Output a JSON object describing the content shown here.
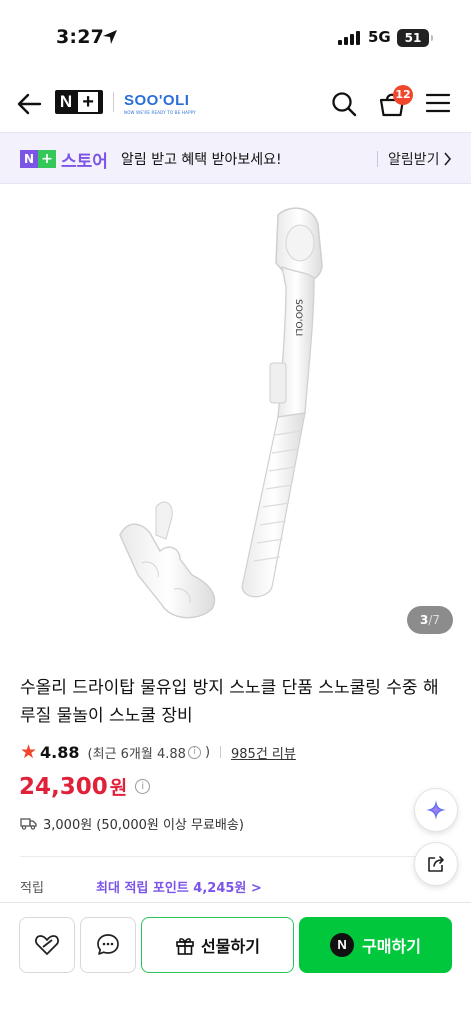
{
  "status_bar": {
    "time": "3:27",
    "network": "5G",
    "battery": "51"
  },
  "header": {
    "nplus_logo": "N",
    "brand_name": "SOO'OLI",
    "brand_tagline": "NOW WE'RE READY TO BE HAPPY",
    "cart_count": "12",
    "icons": [
      "back-arrow-icon",
      "search-icon",
      "cart-icon",
      "menu-icon"
    ]
  },
  "notice": {
    "logo_n": "N",
    "logo_plus": "+",
    "store_label": "스토어",
    "message": "알림 받고 혜택 받아보세요!",
    "action_label": "알림받기"
  },
  "gallery": {
    "current": "3",
    "total": "/7"
  },
  "product": {
    "title": "수올리 드라이탑 물유입 방지 스노클 단품 스노쿨링 수중 해루질 물놀이 스노쿨 장비",
    "rating": "4.88",
    "recent_rating_prefix": "(최근 6개월 4.88",
    "recent_rating_suffix": ")",
    "reviews": "985건 리뷰",
    "price": "24,300",
    "price_unit": "원",
    "shipping": "3,000원 (50,000원 이상 무료배송)",
    "points_label": "적립",
    "points_value": "최대 적립 포인트 4,245원 >"
  },
  "bottom_bar": {
    "gift_label": "선물하기",
    "buy_label": "구매하기",
    "buy_badge": "N"
  },
  "colors": {
    "accent_purple": "#7b54e8",
    "price_red": "#e0213a",
    "buy_green": "#00c73c",
    "badge_red": "#f0472c"
  }
}
